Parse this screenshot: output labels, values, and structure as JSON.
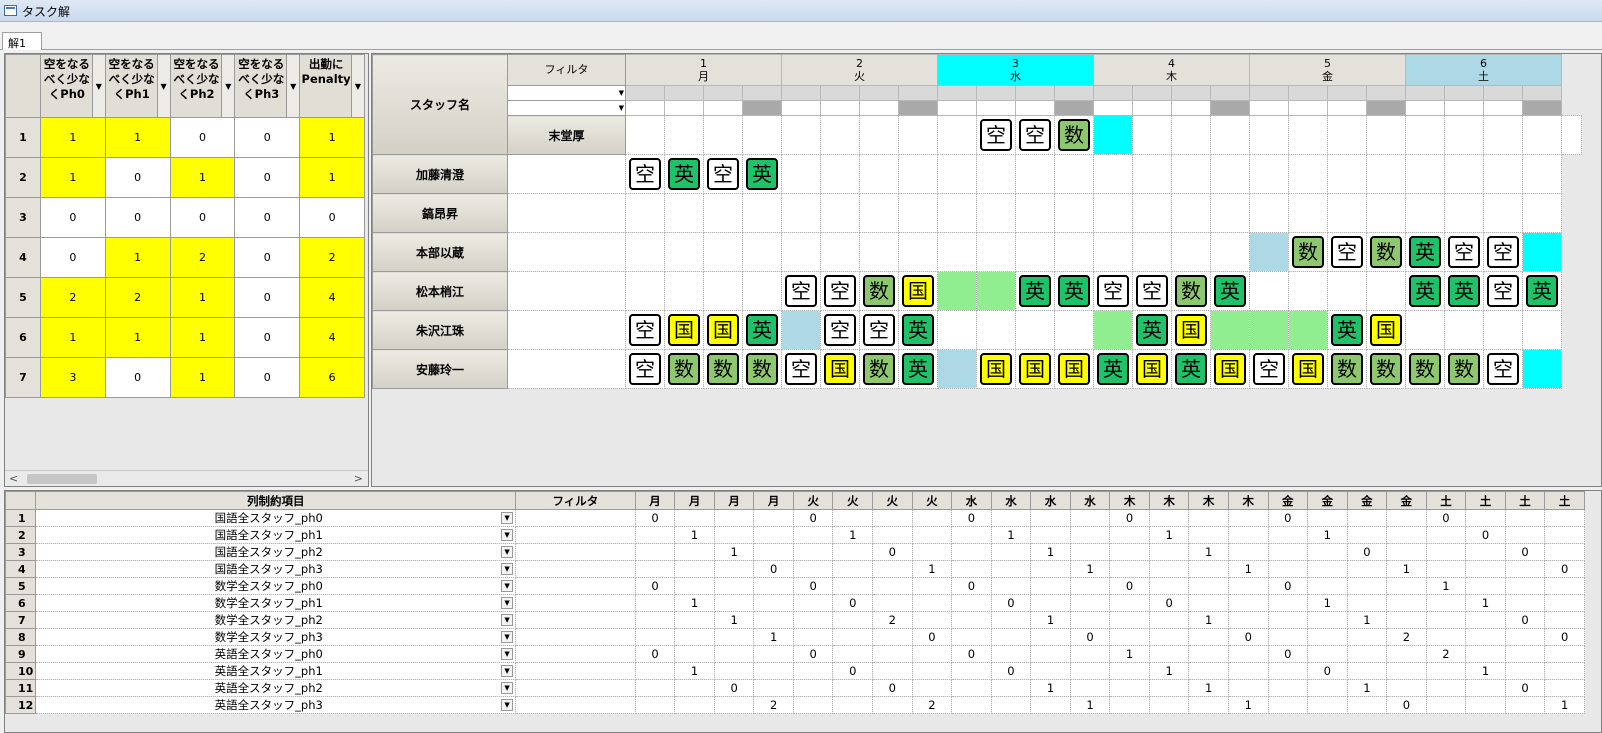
{
  "app": {
    "title": "タスク解",
    "tab": "解1",
    "dropdown_glyph": "▼",
    "scroll_left": "<",
    "scroll_right": ">"
  },
  "summary": {
    "headers": [
      "空をなるべく少なくPh0",
      "空をなるべく少なくPh1",
      "空をなるべく少なくPh2",
      "空をなるべく少なくPh3",
      "出勤にPenalty"
    ],
    "rows": [
      {
        "n": "1",
        "v": [
          "1",
          "1",
          "0",
          "0",
          "1"
        ],
        "hl": [
          1,
          1,
          0,
          0,
          1
        ]
      },
      {
        "n": "2",
        "v": [
          "1",
          "0",
          "1",
          "0",
          "1"
        ],
        "hl": [
          1,
          0,
          1,
          0,
          1
        ]
      },
      {
        "n": "3",
        "v": [
          "0",
          "0",
          "0",
          "0",
          "0"
        ],
        "hl": [
          0,
          0,
          0,
          0,
          0
        ]
      },
      {
        "n": "4",
        "v": [
          "0",
          "1",
          "2",
          "0",
          "2"
        ],
        "hl": [
          0,
          1,
          1,
          0,
          1
        ]
      },
      {
        "n": "5",
        "v": [
          "2",
          "2",
          "1",
          "0",
          "4"
        ],
        "hl": [
          1,
          1,
          1,
          0,
          1
        ]
      },
      {
        "n": "6",
        "v": [
          "1",
          "1",
          "1",
          "0",
          "4"
        ],
        "hl": [
          1,
          1,
          1,
          0,
          1
        ]
      },
      {
        "n": "7",
        "v": [
          "3",
          "0",
          "1",
          "0",
          "6"
        ],
        "hl": [
          1,
          0,
          1,
          0,
          1
        ]
      }
    ]
  },
  "grid": {
    "staff_header": "スタッフ名",
    "filter_header": "フィルタ",
    "days": [
      {
        "num": "1",
        "day": "月",
        "color": "#e3e1d9"
      },
      {
        "num": "2",
        "day": "火",
        "color": "#e3e1d9"
      },
      {
        "num": "3",
        "day": "水",
        "color": "#00ffff"
      },
      {
        "num": "4",
        "day": "木",
        "color": "#e3e1d9"
      },
      {
        "num": "5",
        "day": "金",
        "color": "#e3e1d9"
      },
      {
        "num": "6",
        "day": "土",
        "color": "#add8e6"
      }
    ],
    "staff": [
      "末堂厚",
      "加藤清澄",
      "鎬昂昇",
      "本部以蔵",
      "松本梢江",
      "朱沢江珠",
      "安藤玲一"
    ],
    "cells": [
      [
        "",
        "",
        "",
        "",
        "",
        "",
        "",
        "",
        "空",
        "空",
        "数",
        "cy",
        "",
        "",
        "",
        "",
        "",
        "",
        "",
        "",
        "",
        "",
        "",
        ""
      ],
      [
        "空",
        "英",
        "空",
        "英",
        "",
        "",
        "",
        "",
        "",
        "",
        "",
        "",
        "",
        "",
        "",
        "",
        "",
        "",
        "",
        "",
        "",
        "",
        "",
        ""
      ],
      [
        "",
        "",
        "",
        "",
        "",
        "",
        "",
        "",
        "",
        "",
        "",
        "",
        "",
        "",
        "",
        "",
        "",
        "",
        "",
        "",
        "",
        "",
        "",
        ""
      ],
      [
        "",
        "",
        "",
        "",
        "",
        "",
        "",
        "",
        "",
        "",
        "",
        "",
        "",
        "",
        "",
        "",
        "lb",
        "数",
        "空",
        "数",
        "英",
        "空",
        "空",
        "cy"
      ],
      [
        "",
        "",
        "",
        "",
        "空",
        "空",
        "数",
        "国",
        "lg",
        "lg",
        "英",
        "英",
        "空",
        "空",
        "数",
        "英",
        "",
        "",
        "",
        "",
        "英",
        "英",
        "空",
        "英"
      ],
      [
        "空",
        "国",
        "国",
        "英",
        "lb",
        "空",
        "空",
        "英",
        "",
        "",
        "",
        "",
        "lg",
        "英",
        "国",
        "lg",
        "lg",
        "lg",
        "英",
        "国",
        "",
        "",
        "",
        ""
      ],
      [
        "空",
        "数",
        "数",
        "数",
        "空",
        "国",
        "数",
        "英",
        "lb",
        "国",
        "国",
        "国",
        "英",
        "国",
        "英",
        "国",
        "空",
        "国",
        "数",
        "数",
        "数",
        "数",
        "空",
        "cy"
      ]
    ],
    "colors": {
      "空": "#ffffff",
      "国": "#ffff00",
      "数": "#8dc86e",
      "英": "#1fc268"
    }
  },
  "bottom": {
    "header_name": "列制約項目",
    "header_filter": "フィルタ",
    "day_headers": [
      "月",
      "月",
      "月",
      "月",
      "火",
      "火",
      "火",
      "火",
      "水",
      "水",
      "水",
      "水",
      "木",
      "木",
      "木",
      "木",
      "金",
      "金",
      "金",
      "金",
      "土",
      "土",
      "土",
      "土"
    ],
    "rows": [
      {
        "n": "1",
        "name": "国語全スタッフ_ph0",
        "v": [
          "0",
          "",
          "",
          "",
          "0",
          "",
          "",
          "",
          "0",
          "",
          "",
          "",
          "0",
          "",
          "",
          "",
          "0",
          "",
          "",
          "",
          "0",
          "",
          "",
          ""
        ]
      },
      {
        "n": "2",
        "name": "国語全スタッフ_ph1",
        "v": [
          "",
          "1",
          "",
          "",
          "",
          "1",
          "",
          "",
          "",
          "1",
          "",
          "",
          "",
          "1",
          "",
          "",
          "",
          "1",
          "",
          "",
          "",
          "0",
          "",
          ""
        ]
      },
      {
        "n": "3",
        "name": "国語全スタッフ_ph2",
        "v": [
          "",
          "",
          "1",
          "",
          "",
          "",
          "0",
          "",
          "",
          "",
          "1",
          "",
          "",
          "",
          "1",
          "",
          "",
          "",
          "0",
          "",
          "",
          "",
          "0",
          ""
        ]
      },
      {
        "n": "4",
        "name": "国語全スタッフ_ph3",
        "v": [
          "",
          "",
          "",
          "0",
          "",
          "",
          "",
          "1",
          "",
          "",
          "",
          "1",
          "",
          "",
          "",
          "1",
          "",
          "",
          "",
          "1",
          "",
          "",
          "",
          "0"
        ]
      },
      {
        "n": "5",
        "name": "数学全スタッフ_ph0",
        "v": [
          "0",
          "",
          "",
          "",
          "0",
          "",
          "",
          "",
          "0",
          "",
          "",
          "",
          "0",
          "",
          "",
          "",
          "0",
          "",
          "",
          "",
          "1",
          "",
          "",
          ""
        ]
      },
      {
        "n": "6",
        "name": "数学全スタッフ_ph1",
        "v": [
          "",
          "1",
          "",
          "",
          "",
          "0",
          "",
          "",
          "",
          "0",
          "",
          "",
          "",
          "0",
          "",
          "",
          "",
          "1",
          "",
          "",
          "",
          "1",
          "",
          ""
        ]
      },
      {
        "n": "7",
        "name": "数学全スタッフ_ph2",
        "v": [
          "",
          "",
          "1",
          "",
          "",
          "",
          "2",
          "",
          "",
          "",
          "1",
          "",
          "",
          "",
          "1",
          "",
          "",
          "",
          "1",
          "",
          "",
          "",
          "0",
          ""
        ]
      },
      {
        "n": "8",
        "name": "数学全スタッフ_ph3",
        "v": [
          "",
          "",
          "",
          "1",
          "",
          "",
          "",
          "0",
          "",
          "",
          "",
          "0",
          "",
          "",
          "",
          "0",
          "",
          "",
          "",
          "2",
          "",
          "",
          "",
          "0"
        ]
      },
      {
        "n": "9",
        "name": "英語全スタッフ_ph0",
        "v": [
          "0",
          "",
          "",
          "",
          "0",
          "",
          "",
          "",
          "0",
          "",
          "",
          "",
          "1",
          "",
          "",
          "",
          "0",
          "",
          "",
          "",
          "2",
          "",
          "",
          ""
        ]
      },
      {
        "n": "10",
        "name": "英語全スタッフ_ph1",
        "v": [
          "",
          "1",
          "",
          "",
          "",
          "0",
          "",
          "",
          "",
          "0",
          "",
          "",
          "",
          "1",
          "",
          "",
          "",
          "0",
          "",
          "",
          "",
          "1",
          "",
          ""
        ]
      },
      {
        "n": "11",
        "name": "英語全スタッフ_ph2",
        "v": [
          "",
          "",
          "0",
          "",
          "",
          "",
          "0",
          "",
          "",
          "",
          "1",
          "",
          "",
          "",
          "1",
          "",
          "",
          "",
          "1",
          "",
          "",
          "",
          "0",
          ""
        ]
      },
      {
        "n": "12",
        "name": "英語全スタッフ_ph3",
        "v": [
          "",
          "",
          "",
          "2",
          "",
          "",
          "",
          "2",
          "",
          "",
          "",
          "1",
          "",
          "",
          "",
          "1",
          "",
          "",
          "",
          "0",
          "",
          "",
          "",
          "1"
        ]
      }
    ]
  }
}
